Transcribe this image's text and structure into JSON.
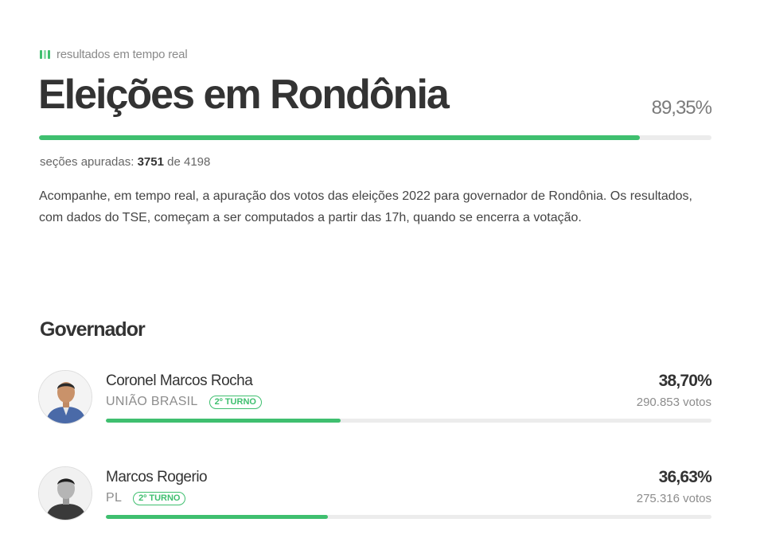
{
  "header": {
    "live_label": "resultados em tempo real",
    "title": "Eleições em Rondônia",
    "percent_counted": "89,35%",
    "progress_fraction": 0.8935,
    "sections_label": "seções apuradas:",
    "sections_counted": "3751",
    "sections_separator": "de",
    "sections_total": "4198",
    "description": "Acompanhe, em tempo real, a apuração dos votos das eleições 2022 para governador de Rondônia. Os resultados, com dados do TSE, começam a ser computados a partir das 17h, quando se encerra a votação."
  },
  "race": {
    "title": "Governador",
    "candidates": [
      {
        "name": "Coronel Marcos Rocha",
        "party": "UNIÃO BRASIL",
        "badge": "2º TURNO",
        "percent": "38,70%",
        "votes": "290.853 votos",
        "share": 0.387
      },
      {
        "name": "Marcos Rogerio",
        "party": "PL",
        "badge": "2º TURNO",
        "percent": "36,63%",
        "votes": "275.316 votos",
        "share": 0.3663
      }
    ]
  },
  "colors": {
    "accent": "#3fbf6f",
    "track": "#ececec",
    "text": "#333333"
  }
}
